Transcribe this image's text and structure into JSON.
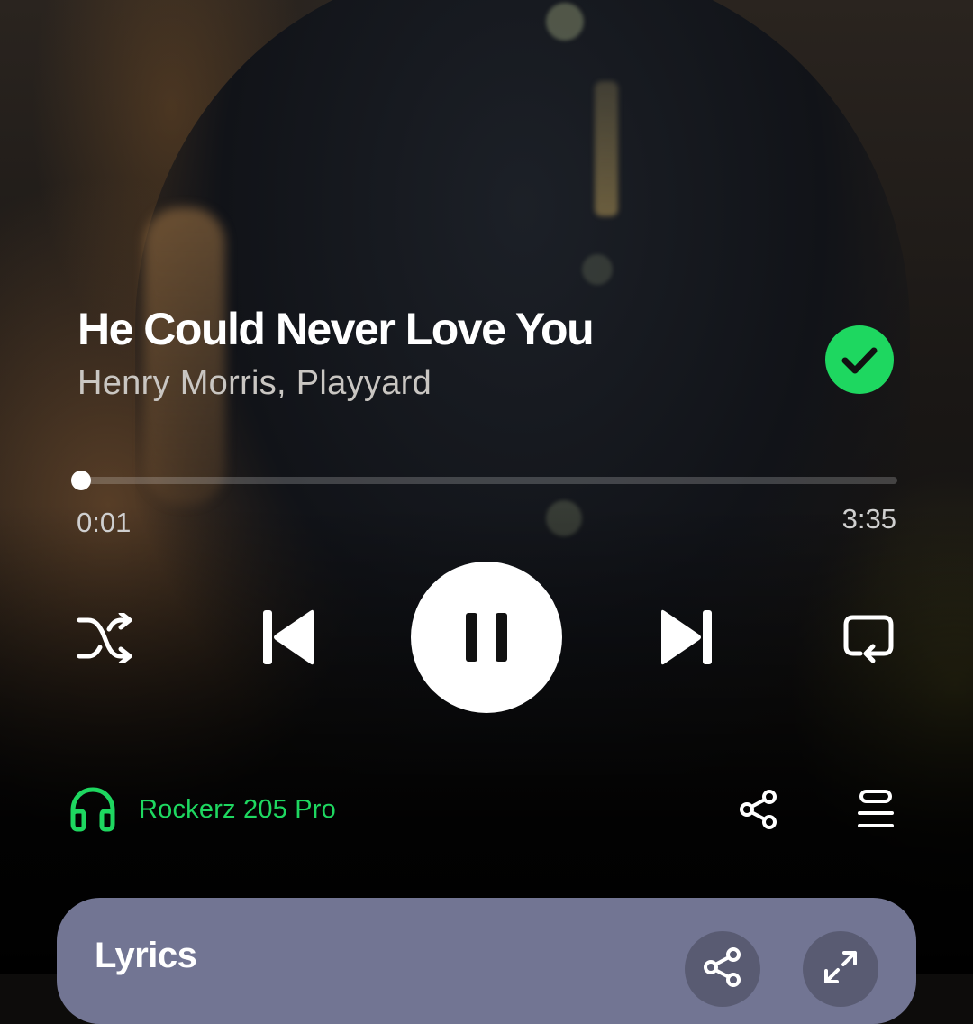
{
  "track": {
    "title": "He Could Never Love You",
    "artists": "Henry Morris, Playyard",
    "liked": true
  },
  "playback": {
    "elapsed": "0:01",
    "duration": "3:35",
    "progress_fraction": 0.005,
    "state": "playing"
  },
  "controls": {
    "shuffle_icon": "shuffle-icon",
    "previous_icon": "skip-previous-icon",
    "play_pause_icon": "pause-icon",
    "next_icon": "skip-next-icon",
    "repeat_icon": "repeat-icon"
  },
  "device": {
    "name": "Rockerz 205 Pro",
    "icon": "headphones-icon"
  },
  "actions": {
    "share_icon": "share-icon",
    "queue_icon": "queue-icon"
  },
  "lyrics": {
    "title": "Lyrics",
    "share_icon": "share-icon",
    "expand_icon": "expand-icon"
  },
  "colors": {
    "accent": "#1ed760",
    "lyrics_card": "#727593",
    "text_secondary": "#c9c6c2"
  }
}
